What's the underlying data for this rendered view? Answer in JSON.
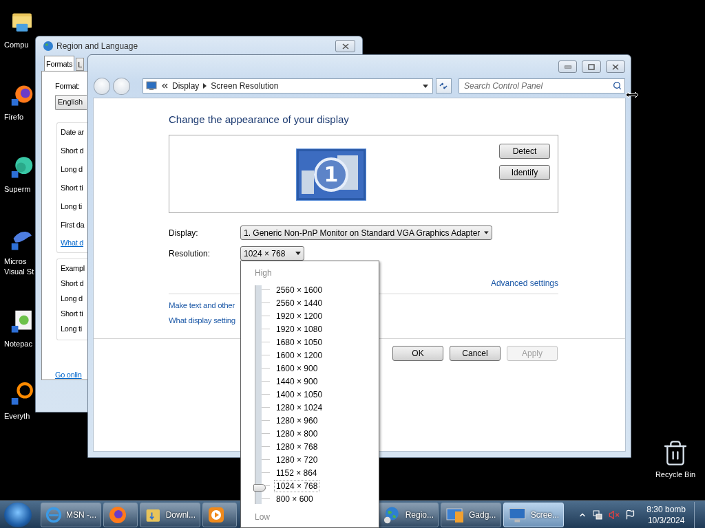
{
  "desktop_icons": [
    {
      "kind": "folder",
      "label": "Compu"
    },
    {
      "kind": "firefox",
      "label": "Firefo"
    },
    {
      "kind": "bubble",
      "label": "Superm"
    },
    {
      "kind": "studio",
      "label": "Micros Visual St"
    },
    {
      "kind": "notepad",
      "label": "Notepac"
    },
    {
      "kind": "ring",
      "label": "Everyth"
    }
  ],
  "region_window": {
    "title": "Region and Language",
    "tabs": [
      {
        "label": "Formats",
        "selected": true
      },
      {
        "label": "L",
        "selected": false
      }
    ],
    "format_label": "Format:",
    "format_value": "English",
    "date_group": {
      "title": "Date ar",
      "rows": [
        "Short d",
        "Long d",
        "Short ti",
        "Long ti",
        "First da"
      ],
      "link": "What d"
    },
    "examples_group": {
      "title": "Exampl",
      "rows": [
        "Short d",
        "Long d",
        "Short ti",
        "Long ti"
      ]
    },
    "online_link": "Go onlin"
  },
  "display_window": {
    "breadcrumb": [
      "Display",
      "Screen Resolution"
    ],
    "search": {
      "placeholder": "Search Control Panel"
    },
    "heading": "Change the appearance of your display",
    "monitor_number": "1",
    "side_buttons": [
      "Detect",
      "Identify"
    ],
    "display_label": "Display:",
    "display_value": "1. Generic Non-PnP Monitor on Standard VGA Graphics Adapter",
    "resolution_label": "Resolution:",
    "resolution_value": "1024 × 768",
    "advanced_link": "Advanced settings",
    "links": [
      "Make text and other",
      "What display setting"
    ],
    "buttons": [
      {
        "label": "OK",
        "disabled": false
      },
      {
        "label": "Cancel",
        "disabled": false
      },
      {
        "label": "Apply",
        "disabled": true
      }
    ]
  },
  "resolution_dropdown": {
    "high": "High",
    "low": "Low",
    "level": 0.0625,
    "options": [
      {
        "label": "2560 × 1600",
        "selected": false
      },
      {
        "label": "2560 × 1440",
        "selected": false
      },
      {
        "label": "1920 × 1200",
        "selected": false
      },
      {
        "label": "1920 × 1080",
        "selected": false
      },
      {
        "label": "1680 × 1050",
        "selected": false
      },
      {
        "label": "1600 × 1200",
        "selected": false
      },
      {
        "label": "1600 × 900",
        "selected": false
      },
      {
        "label": "1440 × 900",
        "selected": false
      },
      {
        "label": "1400 × 1050",
        "selected": false
      },
      {
        "label": "1280 × 1024",
        "selected": false
      },
      {
        "label": "1280 × 960",
        "selected": false
      },
      {
        "label": "1280 × 800",
        "selected": false
      },
      {
        "label": "1280 × 768",
        "selected": false
      },
      {
        "label": "1280 × 720",
        "selected": false
      },
      {
        "label": "1152 × 864",
        "selected": false
      },
      {
        "label": "1024 × 768",
        "selected": true
      },
      {
        "label": "800 × 600",
        "selected": false
      }
    ]
  },
  "recycle_bin": {
    "label": "Recycle Bin"
  },
  "taskbar": {
    "items": [
      {
        "kind": "ie",
        "label": "MSN -...",
        "selected": false
      },
      {
        "kind": "firefox",
        "selected": false
      },
      {
        "kind": "folder",
        "label": "Downl...",
        "selected": false
      },
      {
        "kind": "media",
        "selected": false
      },
      {
        "kind": "globe",
        "label": "Regio...",
        "selected": false
      },
      {
        "kind": "gadget",
        "label": "Gadg...",
        "selected": false
      },
      {
        "kind": "monitor",
        "label": "Scree...",
        "selected": true
      }
    ],
    "time": "8:30 bomb",
    "date": "10/3/2024"
  }
}
